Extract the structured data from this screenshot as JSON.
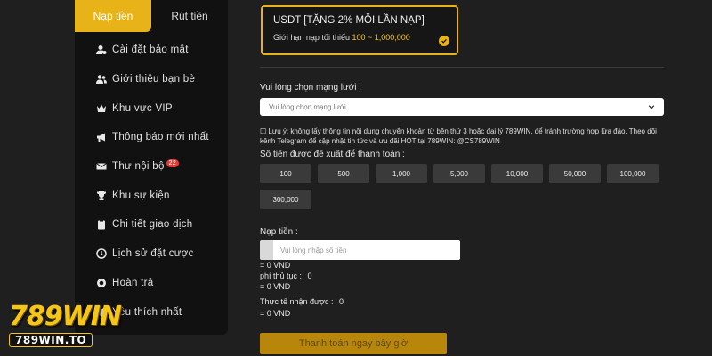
{
  "tabs": {
    "deposit": "Nạp tiền",
    "withdraw": "Rút tiền"
  },
  "menu": [
    {
      "icon": "user-gear-icon",
      "label": "Cài đặt bảo mật"
    },
    {
      "icon": "users-icon",
      "label": "Giới thiệu bạn bè"
    },
    {
      "icon": "crown-icon",
      "label": "Khu vực VIP"
    },
    {
      "icon": "megaphone-icon",
      "label": "Thông báo mới nhất"
    },
    {
      "icon": "envelope-icon",
      "label": "Thư nội bộ",
      "badge": "22"
    },
    {
      "icon": "trophy-icon",
      "label": "Khu sự kiện"
    },
    {
      "icon": "clipboard-icon",
      "label": "Chi tiết giao dịch"
    },
    {
      "icon": "history-icon",
      "label": "Lịch sử đặt cược"
    },
    {
      "icon": "refund-icon",
      "label": "Hoàn trả"
    },
    {
      "icon": "heart-icon",
      "label": "Yêu thích nhất"
    }
  ],
  "logo": {
    "main": "789WIN",
    "sub": "789WIN.TO"
  },
  "usdt": {
    "title": "USDT [TẶNG 2% MỖI LẦN NẠP]",
    "limit_prefix": "Giới hạn nạp tối thiểu",
    "limit_value": "100 ~ 1,000,000"
  },
  "network": {
    "label": "Vui lòng chọn mạng lưới :",
    "placeholder": "Vui lòng chọn mạng lưới"
  },
  "note": "☐ Lưu ý: không lấy thông tin nội dung chuyển khoản từ bên thứ 3 hoặc đại lý 789WIN, để tránh trường hợp lừa đảo. Theo dõi kênh Telegram để cập nhật tin tức và ưu đãi HOT tại 789WIN: @CS789WIN",
  "suggest_label": "Số tiền được đề xuất để thanh toán :",
  "amounts": [
    "100",
    "500",
    "1,000",
    "5,000",
    "10,000",
    "50,000",
    "100,000",
    "300,000"
  ],
  "deposit": {
    "label": "Nạp tiền :",
    "placeholder": "Vui lòng nhập số tiền",
    "converted": "= 0 VND",
    "fee_label": "phí thủ tục :",
    "fee_value": "0",
    "fee_converted": "= 0 VND",
    "actual_label": "Thực tế nhận được :",
    "actual_value": "0",
    "actual_converted": "= 0 VND"
  },
  "submit_label": "Thanh toán ngay bây giờ",
  "colors": {
    "accent": "#e8b319",
    "background": "#1f1f1f",
    "sidebar": "#111111"
  }
}
